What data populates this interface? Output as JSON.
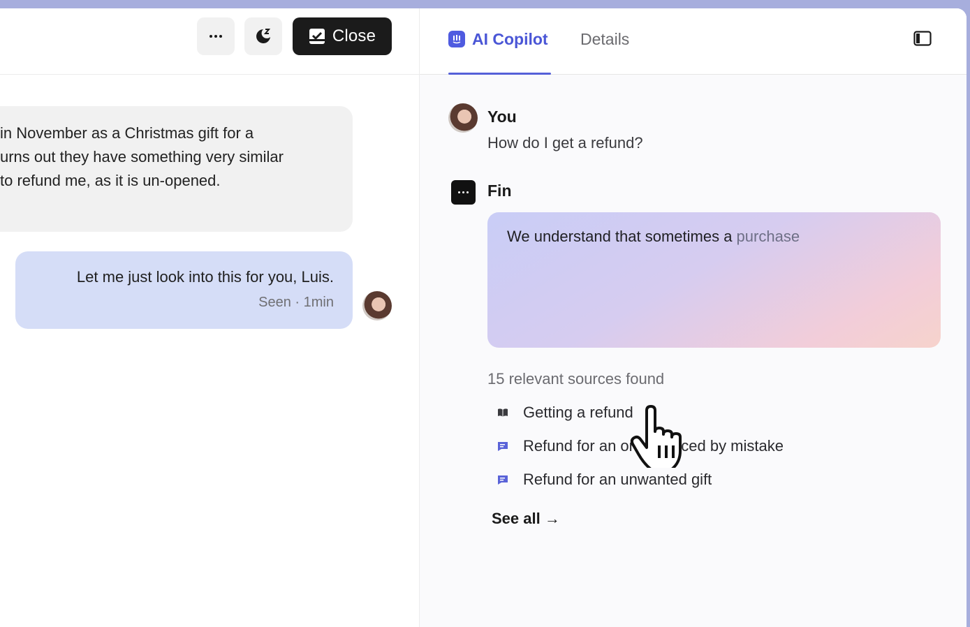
{
  "header": {
    "close_label": "Close"
  },
  "conversation": {
    "incoming_lines": [
      "in November as a Christmas gift for a",
      "urns out they have something very similar",
      "to refund me, as it is un-opened."
    ],
    "outgoing": {
      "message": "Let me just look into this for you, Luis.",
      "meta": "Seen · 1min"
    }
  },
  "copilot": {
    "tabs": {
      "copilot_label": "AI Copilot",
      "details_label": "Details"
    },
    "question": {
      "sender": "You",
      "text": "How do I get a refund?"
    },
    "answer": {
      "sender": "Fin",
      "text_main": "We understand that sometimes a ",
      "text_fading": "purchase"
    },
    "sources": {
      "heading": "15 relevant sources found",
      "items": [
        {
          "label": "Getting a refund",
          "icon": "book-icon"
        },
        {
          "label": "Refund for an order placed by mistake",
          "icon": "chat-bubble-icon"
        },
        {
          "label": "Refund for an unwanted gift",
          "icon": "chat-bubble-icon"
        }
      ],
      "see_all_label": "See all →"
    }
  },
  "colors": {
    "accent": "#4a56d6",
    "outgoing_bubble": "#d5ddf7",
    "incoming_bubble": "#f1f1f1",
    "close_button": "#1b1b1b"
  }
}
